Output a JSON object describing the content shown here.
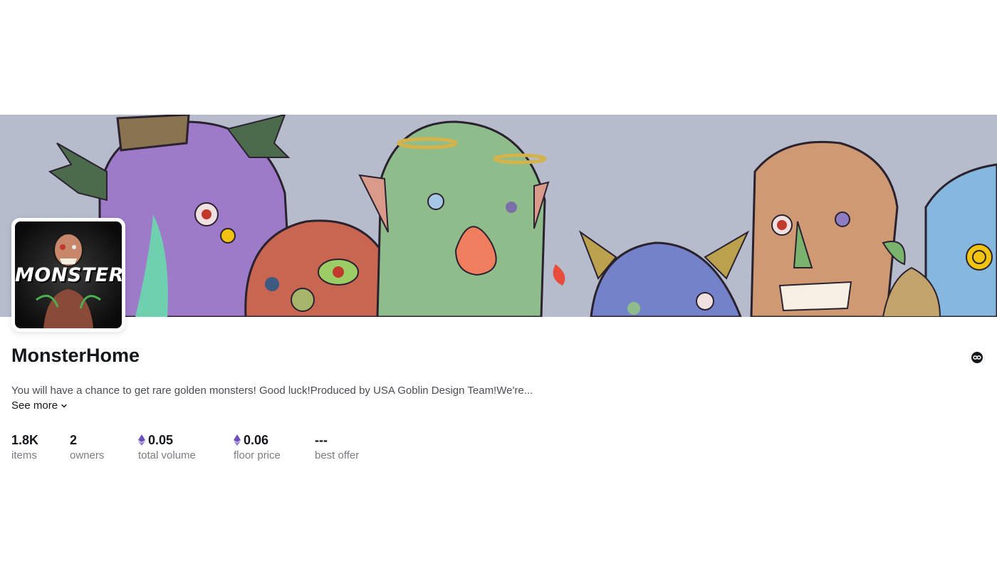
{
  "collection": {
    "name": "MonsterHome",
    "description": "You will have a chance to get rare golden monsters! Good luck!Produced by USA Goblin Design Team!We're...",
    "see_more_label": "See more",
    "avatar_text": "MONSTER"
  },
  "stats": [
    {
      "value": "1.8K",
      "label": "items",
      "currency_icon": null
    },
    {
      "value": "2",
      "label": "owners",
      "currency_icon": null
    },
    {
      "value": "0.05",
      "label": "total volume",
      "currency_icon": "ethereum-icon"
    },
    {
      "value": "0.06",
      "label": "floor price",
      "currency_icon": "ethereum-icon"
    },
    {
      "value": "---",
      "label": "best offer",
      "currency_icon": null
    }
  ],
  "icons": {
    "link": "link-icon",
    "see_more": "chevron-down-icon",
    "currency": "ethereum-icon"
  },
  "colors": {
    "banner_background": "#b6bccb",
    "eth_purple": "#6b4fbb",
    "text_primary": "#14171a",
    "text_secondary": "#7a7d82"
  }
}
